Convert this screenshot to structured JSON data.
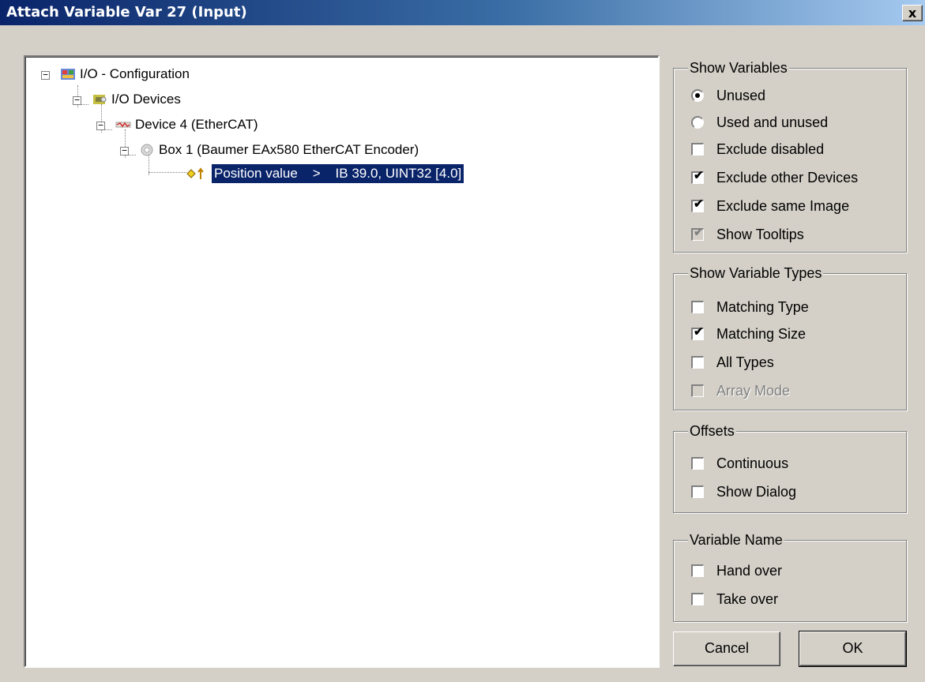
{
  "window": {
    "title": "Attach Variable Var 27 (Input)",
    "close_label": "x"
  },
  "tree": {
    "nodes": [
      {
        "label": "I/O - Configuration",
        "icon": "io-configuration-icon",
        "expander": "−"
      },
      {
        "label": "I/O Devices",
        "icon": "io-devices-icon",
        "expander": "−"
      },
      {
        "label": "Device 4 (EtherCAT)",
        "icon": "ethercat-device-icon",
        "expander": "−"
      },
      {
        "label": "Box 1 (Baumer EAx580 EtherCAT Encoder)",
        "icon": "box-icon",
        "expander": "−"
      },
      {
        "label": "Position value    >    IB 39.0, UINT32 [4.0]",
        "icon": "input-variable-icon",
        "selected": true
      }
    ]
  },
  "show_variables": {
    "title": "Show Variables",
    "unused": {
      "label": "Unused",
      "checked": true
    },
    "used_and_unused": {
      "label": "Used and unused",
      "checked": false
    },
    "exclude_disabled": {
      "label": "Exclude disabled",
      "checked": false
    },
    "exclude_other_devices": {
      "label": "Exclude other Devices",
      "checked": true
    },
    "exclude_same_image": {
      "label": "Exclude same Image",
      "checked": true
    },
    "show_tooltips": {
      "label": "Show Tooltips",
      "checked": true,
      "disabled": true
    }
  },
  "show_variable_types": {
    "title": "Show Variable Types",
    "matching_type": {
      "label": "Matching Type",
      "checked": false
    },
    "matching_size": {
      "label": "Matching Size",
      "checked": true
    },
    "all_types": {
      "label": "All Types",
      "checked": false
    },
    "array_mode": {
      "label": "Array Mode",
      "checked": false,
      "disabled": true
    }
  },
  "offsets": {
    "title": "Offsets",
    "continuous": {
      "label": "Continuous",
      "checked": false
    },
    "show_dialog": {
      "label": "Show Dialog",
      "checked": false
    }
  },
  "variable_name": {
    "title": "Variable Name",
    "hand_over": {
      "label": "Hand over",
      "checked": false
    },
    "take_over": {
      "label": "Take over",
      "checked": false
    }
  },
  "buttons": {
    "cancel": "Cancel",
    "ok": "OK"
  },
  "check_glyph": "✔"
}
